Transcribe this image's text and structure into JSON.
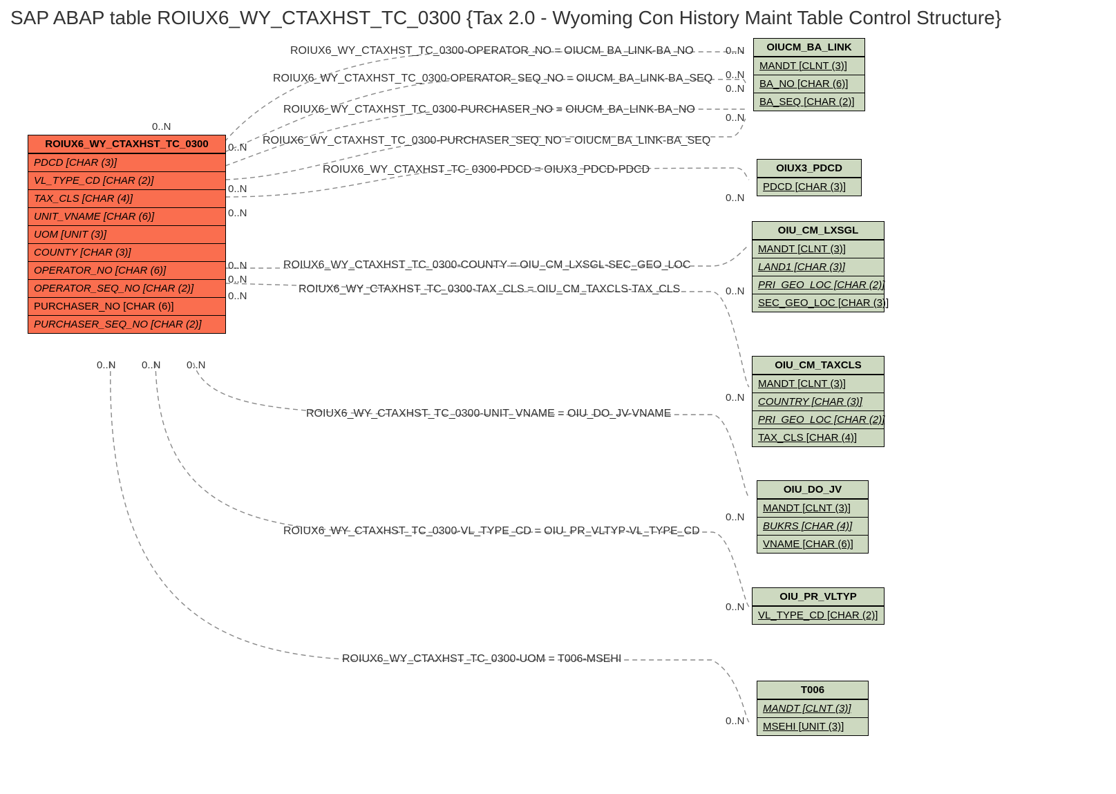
{
  "title": "SAP ABAP table ROIUX6_WY_CTAXHST_TC_0300 {Tax 2.0 - Wyoming Con History Maint Table Control Structure}",
  "mainEntity": {
    "name": "ROIUX6_WY_CTAXHST_TC_0300",
    "fields": [
      "PDCD [CHAR (3)]",
      "VL_TYPE_CD [CHAR (2)]",
      "TAX_CLS [CHAR (4)]",
      "UNIT_VNAME [CHAR (6)]",
      "UOM [UNIT (3)]",
      "COUNTY [CHAR (3)]",
      "OPERATOR_NO [CHAR (6)]",
      "OPERATOR_SEQ_NO [CHAR (2)]",
      "PURCHASER_NO [CHAR (6)]",
      "PURCHASER_SEQ_NO [CHAR (2)]"
    ]
  },
  "targets": {
    "ba_link": {
      "name": "OIUCM_BA_LINK",
      "fields": [
        "MANDT [CLNT (3)]",
        "BA_NO [CHAR (6)]",
        "BA_SEQ [CHAR (2)]"
      ]
    },
    "pdcd": {
      "name": "OIUX3_PDCD",
      "fields": [
        "PDCD [CHAR (3)]"
      ]
    },
    "lxsgl": {
      "name": "OIU_CM_LXSGL",
      "fields": [
        "MANDT [CLNT (3)]",
        "LAND1 [CHAR (3)]",
        "PRI_GEO_LOC [CHAR (2)]",
        "SEC_GEO_LOC [CHAR (3)]"
      ]
    },
    "taxcls": {
      "name": "OIU_CM_TAXCLS",
      "fields": [
        "MANDT [CLNT (3)]",
        "COUNTRY [CHAR (3)]",
        "PRI_GEO_LOC [CHAR (2)]",
        "TAX_CLS [CHAR (4)]"
      ]
    },
    "do_jv": {
      "name": "OIU_DO_JV",
      "fields": [
        "MANDT [CLNT (3)]",
        "BUKRS [CHAR (4)]",
        "VNAME [CHAR (6)]"
      ]
    },
    "vltyp": {
      "name": "OIU_PR_VLTYP",
      "fields": [
        "VL_TYPE_CD [CHAR (2)]"
      ]
    },
    "t006": {
      "name": "T006",
      "fields": [
        "MANDT [CLNT (3)]",
        "MSEHI [UNIT (3)]"
      ]
    }
  },
  "relLabels": {
    "r1": "ROIUX6_WY_CTAXHST_TC_0300-OPERATOR_NO = OIUCM_BA_LINK-BA_NO",
    "r2": "ROIUX6_WY_CTAXHST_TC_0300-OPERATOR_SEQ_NO = OIUCM_BA_LINK-BA_SEQ",
    "r3": "ROIUX6_WY_CTAXHST_TC_0300-PURCHASER_NO = OIUCM_BA_LINK-BA_NO",
    "r4": "ROIUX6_WY_CTAXHST_TC_0300-PURCHASER_SEQ_NO = OIUCM_BA_LINK-BA_SEQ",
    "r5": "ROIUX6_WY_CTAXHST_TC_0300-PDCD = OIUX3_PDCD-PDCD",
    "r6": "ROIUX6_WY_CTAXHST_TC_0300-COUNTY = OIU_CM_LXSGL-SEC_GEO_LOC",
    "r7": "ROIUX6_WY_CTAXHST_TC_0300-TAX_CLS = OIU_CM_TAXCLS-TAX_CLS",
    "r8": "ROIUX6_WY_CTAXHST_TC_0300-UNIT_VNAME = OIU_DO_JV-VNAME",
    "r9": "ROIUX6_WY_CTAXHST_TC_0300-VL_TYPE_CD = OIU_PR_VLTYP-VL_TYPE_CD",
    "r10": "ROIUX6_WY_CTAXHST_TC_0300-UOM = T006-MSEHI"
  },
  "card": "0..N"
}
